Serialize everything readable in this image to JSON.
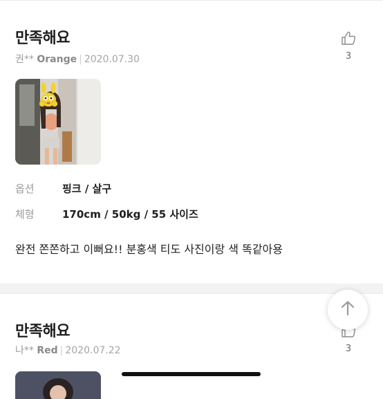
{
  "reviews": [
    {
      "title": "만족해요",
      "author": "권**",
      "color": "Orange",
      "date": "2020.07.30",
      "likes": "3",
      "option_label": "옵션",
      "option_value": "핑크 / 살구",
      "body_label": "체형",
      "body_value": "170cm / 50kg / 55 사이즈",
      "text": "완전 쫀쫀하고 이뻐요!! 분홍색 티도 사진이랑 색 똑같아용"
    },
    {
      "title": "만족해요",
      "author": "나**",
      "color": "Red",
      "date": "2020.07.22",
      "likes": "3"
    }
  ],
  "meta_separator": "|",
  "icons": {
    "like": "thumbs-up-icon",
    "scroll_top": "arrow-up-icon"
  },
  "colors": {
    "text_primary": "#1e1e1e",
    "text_secondary": "#a5a5a5",
    "divider": "#f3f3f3"
  }
}
